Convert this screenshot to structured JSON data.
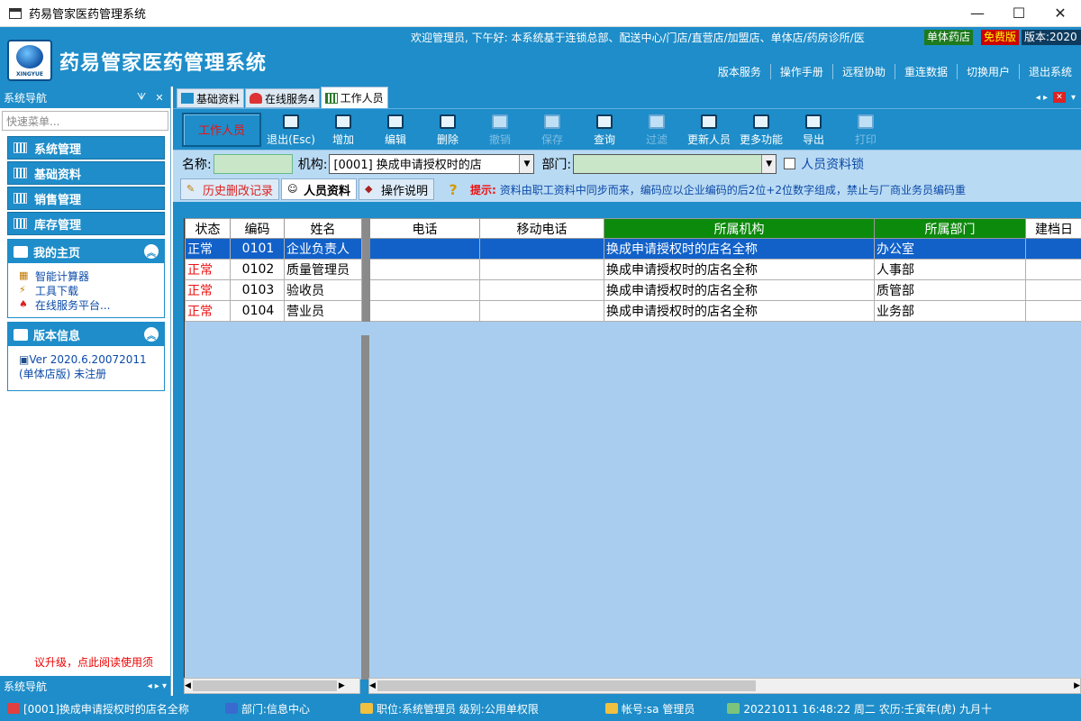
{
  "window": {
    "title": "药易管家医药管理系统",
    "minimize": "—",
    "maximize": "☐",
    "close": "✕"
  },
  "banner": {
    "logo_text": "XINGYUE",
    "app_title": "药易管家医药管理系统",
    "welcome": "欢迎管理员, 下午好:   本系统基于连锁总部、配送中心/门店/直营店/加盟店、单体店/药房诊所/医",
    "tag_green": "单体药店",
    "tag_red": "免费版",
    "tag_version": "版本:2020",
    "links": [
      "版本服务",
      "操作手册",
      "远程协助",
      "重连数据",
      "切换用户",
      "退出系统"
    ]
  },
  "sidebar": {
    "header": "系统导航",
    "pin": "ᗐ",
    "close": "✕",
    "quick_placeholder": "快速菜单...",
    "menu": [
      {
        "label": "系统管理"
      },
      {
        "label": "基础资料"
      },
      {
        "label": "销售管理"
      },
      {
        "label": "库存管理"
      }
    ],
    "my_home": {
      "title": "我的主页",
      "links": [
        "智能计算器",
        "工具下载",
        "在线服务平台..."
      ]
    },
    "version_info": {
      "title": "版本信息",
      "line1": "Ver 2020.6.20072011",
      "line2": "(单体店版) 未注册"
    },
    "notice": "议升级，点此阅读使用须",
    "footer": "系统导航"
  },
  "doc_tabs": [
    {
      "label": "基础资料"
    },
    {
      "label": "在线服务4"
    },
    {
      "label": "工作人员"
    }
  ],
  "toolbar": {
    "title": "工作人员",
    "buttons": [
      {
        "label": "退出(Esc)",
        "enabled": true
      },
      {
        "label": "增加",
        "enabled": true
      },
      {
        "label": "编辑",
        "enabled": true
      },
      {
        "label": "删除",
        "enabled": true
      },
      {
        "label": "撤销",
        "enabled": false
      },
      {
        "label": "保存",
        "enabled": false
      },
      {
        "label": "查询",
        "enabled": true
      },
      {
        "label": "过滤",
        "enabled": false
      },
      {
        "label": "更新人员",
        "enabled": true
      },
      {
        "label": "更多功能",
        "enabled": true
      },
      {
        "label": "导出",
        "enabled": true
      },
      {
        "label": "打印",
        "enabled": false
      }
    ]
  },
  "filters": {
    "name_label": "名称:",
    "name_value": "",
    "org_label": "机构:",
    "org_value": "[0001] 换成申请授权时的店",
    "dept_label": "部门:",
    "dept_value": "",
    "lock_label": "人员资料锁"
  },
  "sub_tabs": {
    "history": "历史删改记录",
    "staff": "人员资料",
    "guide": "操作说明",
    "hint_label": "提示:",
    "hint_text": "资料由职工资料中同步而来，编码应以企业编码的后2位+2位数字组成，禁止与厂商业务员编码重"
  },
  "grid": {
    "columns": [
      "状态",
      "编码",
      "姓名",
      "电话",
      "移动电话",
      "所属机构",
      "所属部门",
      "建档日"
    ],
    "rows": [
      {
        "status": "正常",
        "code": "0101",
        "name": "企业负责人",
        "phone": "",
        "mobile": "",
        "org": "换成申请授权时的店名全称",
        "dept": "办公室",
        "date": ""
      },
      {
        "status": "正常",
        "code": "0102",
        "name": "质量管理员",
        "phone": "",
        "mobile": "",
        "org": "换成申请授权时的店名全称",
        "dept": "人事部",
        "date": ""
      },
      {
        "status": "正常",
        "code": "0103",
        "name": "验收员",
        "phone": "",
        "mobile": "",
        "org": "换成申请授权时的店名全称",
        "dept": "质管部",
        "date": ""
      },
      {
        "status": "正常",
        "code": "0104",
        "name": "营业员",
        "phone": "",
        "mobile": "",
        "org": "换成申请授权时的店名全称",
        "dept": "业务部",
        "date": ""
      }
    ]
  },
  "statusbar": {
    "org": "[0001]换成申请授权时的店名全称",
    "dept": "部门:信息中心",
    "role": "职位:系统管理员  级别:公用单权限",
    "account": "帐号:sa 管理员",
    "datetime": "20221011  16:48:22  周二  农历:壬寅年(虎) 九月十"
  },
  "colors": {
    "accent": "#1e8dc9",
    "grid_bg": "#a9cdee",
    "selected_row": "#1161c9",
    "header_green": "#0c8a0c"
  }
}
